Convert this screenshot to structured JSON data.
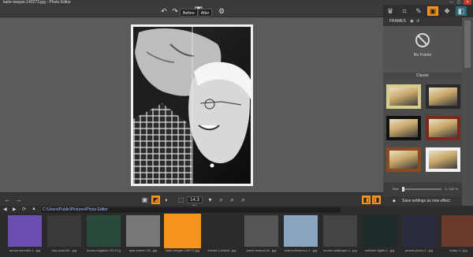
{
  "window": {
    "title": "katie-megan-140273.jpg - Photo Editor",
    "controls": [
      "—",
      "▢",
      "✕"
    ]
  },
  "toolbar": {
    "undo": "↶",
    "redo": "↷",
    "redo_all": "↷",
    "save": "💾",
    "settings": "⚙",
    "before_label": "Before",
    "after_label": "After"
  },
  "bottom_tools": {
    "prev": "←",
    "next": "→",
    "zoom_value": "14.3 %",
    "zoom_in": "+",
    "zoom_out": "−",
    "search": "⌕"
  },
  "path": {
    "value": "C:\\Users\\Public\\Pictures\\Photo Editor"
  },
  "filmstrip": {
    "items": [
      {
        "label": "aurora-borealis-1...jpg",
        "color": "#6a4fb0"
      },
      {
        "label": "boy-snow-80...jpg",
        "color": "#3a3a3a"
      },
      {
        "label": "dunes-negative-20170.jpg",
        "color": "#2a4a3a"
      },
      {
        "label": "ipad-screen-18...jpg",
        "color": "#777777"
      },
      {
        "label": "katie-megan-140273.jpg",
        "color": "#f7941d"
      },
      {
        "label": "krmwh-1-ballad...jpg",
        "color": "#2a2a2a"
      },
      {
        "label": "pavel-beraud-18...jpg",
        "color": "#555555"
      },
      {
        "label": "sharon-flowers-c-1...jpg",
        "color": "#8aa4bf"
      },
      {
        "label": "smoke-wallpaper-1...jpg",
        "color": "#444444"
      },
      {
        "label": "northern-lights-1...jpg",
        "color": "#1c2a2a"
      },
      {
        "label": "pexels-photo-1...jpg",
        "color": "#2b2b3f"
      },
      {
        "label": "trump-1...jpg",
        "color": "#6a3a2a"
      }
    ]
  },
  "sidepanel": {
    "tabs": [
      "♛",
      "⌗",
      "✎",
      "▣",
      "❖",
      "◧"
    ],
    "frames_header": "FRAMES",
    "no_frame_label": "No Frame",
    "classic_label": "Classic",
    "size_label": "Size",
    "size_value": "1 / 100 %",
    "save_settings": "Save settings as new effect",
    "frames": [
      {
        "name": "frame-light-wood",
        "border": "#d6cd8a"
      },
      {
        "name": "frame-dark-gray",
        "border": "#2a2a2a"
      },
      {
        "name": "frame-black-white",
        "border": "#111111"
      },
      {
        "name": "frame-red-wood",
        "border": "#7a2a1a"
      },
      {
        "name": "frame-ornate-wood",
        "border": "#8a4a1e"
      },
      {
        "name": "frame-white",
        "border": "#f2f2f2"
      }
    ]
  },
  "colors": {
    "accent": "#f7941d",
    "panel": "#3d3d3d",
    "canvas": "#5b5b5b"
  }
}
